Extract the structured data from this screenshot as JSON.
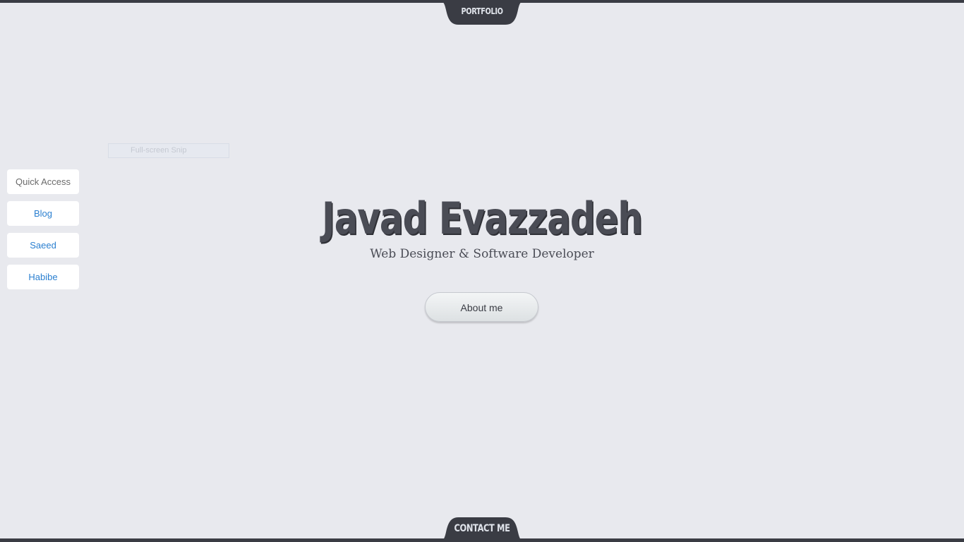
{
  "nav": {
    "top_tab_label": "PORTFOLIO",
    "bottom_tab_label": "CONTACT ME"
  },
  "quick_access": {
    "header": "Quick Access",
    "items": [
      {
        "label": "Blog"
      },
      {
        "label": "Saeed"
      },
      {
        "label": "Habibe"
      }
    ]
  },
  "snip_overlay": {
    "label": "Full-screen Snip"
  },
  "hero": {
    "title": "Javad Evazzadeh",
    "subtitle": "Web Designer & Software Developer",
    "button_label": "About me"
  },
  "colors": {
    "background": "#e8e9ee",
    "dark_bar": "#3a3c44",
    "link_blue": "#2a7fd0",
    "title_gray": "#4a4c55"
  }
}
